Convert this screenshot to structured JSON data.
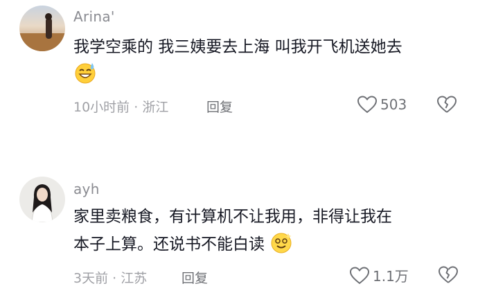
{
  "comments": [
    {
      "username": "Arina'",
      "text": "我学空乘的 我三姨要去上海 叫我开飞机送她去",
      "emoji_name": "sweat-smile-emoji",
      "time": "10小时前",
      "location": "浙江",
      "reply_label": "回复",
      "likes": "503"
    },
    {
      "username": "ayh",
      "text_line1": "家里卖粮食，有计算机不让我用，非得让我在",
      "text_line2": "本子上算。还说书不能白读",
      "emoji_name": "dizzy-smile-emoji",
      "time": "3天前",
      "location": "江苏",
      "reply_label": "回复",
      "likes": "1.1万"
    }
  ],
  "separator": "·",
  "colors": {
    "text": "#161823",
    "meta": "#9fa0a5",
    "action": "#6e7075"
  }
}
